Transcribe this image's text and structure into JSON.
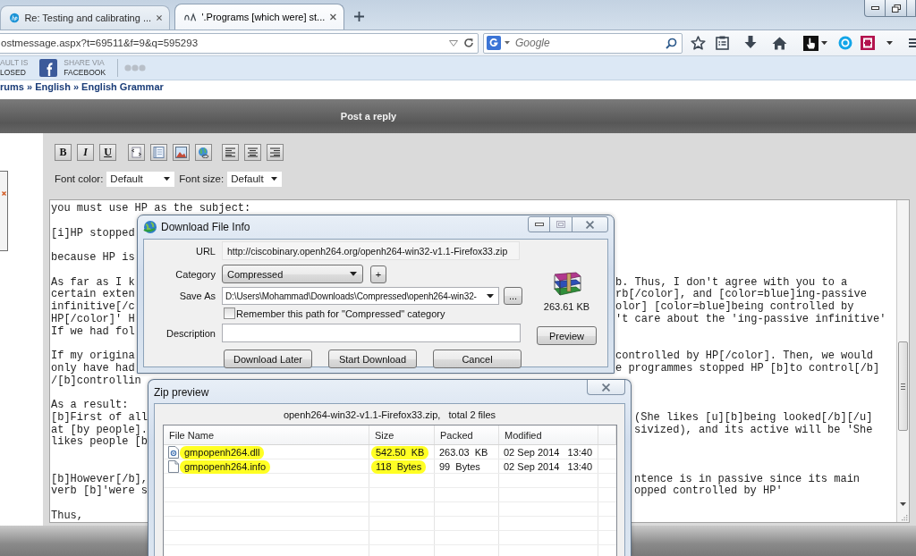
{
  "browser": {
    "tabs": [
      {
        "title": "Re: Testing and calibrating ...",
        "selected": false
      },
      {
        "title": "'.Programs [which were] st...",
        "selected": true
      }
    ],
    "address": "ostmessage.aspx?t=69511&f=9&q=595293",
    "search": {
      "placeholder": "Google"
    },
    "addons": [
      {
        "kind": "plain",
        "line_1": "AULT IS",
        "line_2": "LOSED"
      },
      {
        "kind": "facebook",
        "line_1": "SHARE VIA",
        "line_2": "FACEBOOK"
      }
    ]
  },
  "page": {
    "breadcrumb": "rums » English » English Grammar",
    "header": "Post a reply",
    "style_buttons": [
      "B",
      "I",
      "U"
    ],
    "font_color": {
      "label": "Font color:",
      "value": "Default"
    },
    "font_size": {
      "label": "Font size:",
      "value": "Default"
    },
    "editor": {
      "paragraphs": [
        [
          {
            "left": "you must use HP as the subject:"
          }
        ],
        [
          {
            "left": "[i]HP stopped"
          }
        ],
        [
          {
            "left": "because HP is"
          }
        ],
        [
          {
            "left": "As far as I k",
            "right": "b. Thus, I don't agree with you to a"
          },
          {
            "left": "certain exten",
            "right": "rb[/color], and [color=blue]ing-passive"
          },
          {
            "left": "infinitive[/c",
            "right": "olor] [color=blue]being controlled by"
          },
          {
            "left": "HP[/color]' H",
            "right": "'t care about the 'ing-passive infinitive'"
          },
          {
            "left": "If we had fol"
          }
        ],
        [
          {
            "left": "If my origina",
            "right": "controlled by HP[/color]. Then, we would"
          },
          {
            "left": "only have had",
            "right": "e programmes stopped HP [b]to control[/b]"
          },
          {
            "left": "/[b]controllin"
          }
        ],
        [
          {
            "left": "As a result:"
          },
          {
            "left": "[b]First of all",
            "right": "(She likes [u][b]being looked[/b][/u]"
          },
          {
            "left": "at [by people].",
            "right": "sivized), and its active will be 'She"
          },
          {
            "left": "likes people [b"
          }
        ],
        [
          {
            "left": "[b]However[/b],",
            "right": "ntence is in passive since its main"
          },
          {
            "left": "verb [b]'were s",
            "right": "opped controlled by HP'"
          }
        ],
        [
          {
            "left": "Thus,"
          }
        ]
      ]
    }
  },
  "download_dialog": {
    "title": "Download File Info",
    "url": {
      "label": "URL",
      "value": "http://ciscobinary.openh264.org/openh264-win32-v1.1-Firefox33.zip"
    },
    "category": {
      "label": "Category",
      "value": "Compressed",
      "add": "+"
    },
    "save_as": {
      "label": "Save As",
      "value": "D:\\Users\\Mohammad\\Downloads\\Compressed\\openh264-win32-",
      "browse": "..."
    },
    "remember": {
      "label": "Remember this path for \"Compressed\" category",
      "checked": false
    },
    "description": {
      "label": "Description"
    },
    "size": "263.61 KB",
    "preview": "Preview",
    "buttons": [
      "Download Later",
      "Start Download",
      "Cancel"
    ]
  },
  "zip_dialog": {
    "title": "Zip preview",
    "summary": "openh264-win32-v1.1-Firefox33.zip,   total 2 files",
    "columns": [
      "File Name",
      "Size",
      "Packed",
      "Modified"
    ],
    "rows": [
      {
        "kind": "dll",
        "name": "gmpopenh264.dll",
        "size": "542.50  KB",
        "packed": "263.03  KB",
        "modified": "02 Sep 2014   13:40",
        "highlighted": true
      },
      {
        "kind": "file",
        "name": "gmpopenh264.info",
        "size": "118  Bytes",
        "packed": "99  Bytes",
        "modified": "02 Sep 2014   13:40",
        "highlighted": true
      }
    ]
  }
}
